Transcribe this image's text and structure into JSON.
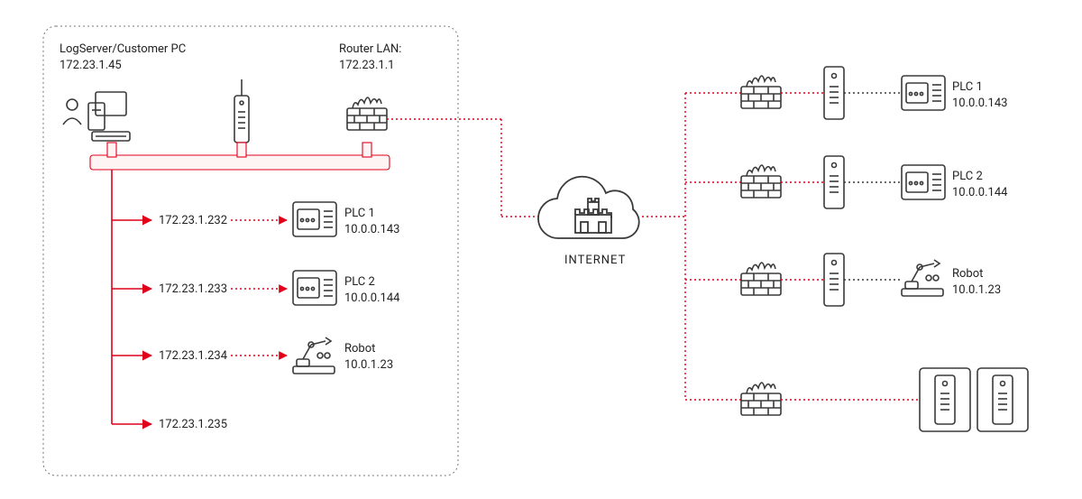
{
  "left_box": {
    "logserver_label": "LogServer/Customer PC",
    "logserver_ip": "172.23.1.45",
    "router_label": "Router LAN:",
    "router_ip": "172.23.1.1",
    "devices": [
      {
        "virtual_ip": "172.23.1.232",
        "name": "PLC 1",
        "real_ip": "10.0.0.143"
      },
      {
        "virtual_ip": "172.23.1.233",
        "name": "PLC 2",
        "real_ip": "10.0.0.144"
      },
      {
        "virtual_ip": "172.23.1.234",
        "name": "Robot",
        "real_ip": "10.0.1.23"
      },
      {
        "virtual_ip": "172.23.1.235",
        "name": "",
        "real_ip": ""
      }
    ]
  },
  "center": {
    "internet_label": "INTERNET"
  },
  "right_side": {
    "devices": [
      {
        "name": "PLC 1",
        "ip": "10.0.0.143"
      },
      {
        "name": "PLC 2",
        "ip": "10.0.0.144"
      },
      {
        "name": "Robot",
        "ip": "10.0.1.23"
      },
      {
        "name": "",
        "ip": ""
      }
    ]
  },
  "colors": {
    "red": "#e1001a",
    "stroke": "#3a3a3a",
    "dash_box": "#aaa"
  }
}
